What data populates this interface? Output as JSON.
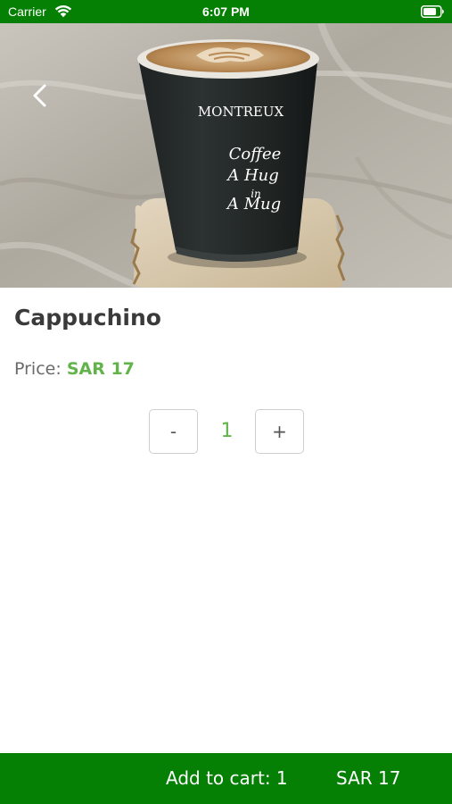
{
  "status_bar": {
    "carrier": "Carrier",
    "time": "6:07 PM",
    "wifi_icon": "wifi-icon",
    "battery_icon": "battery-icon"
  },
  "hero": {
    "cup_brand": "MONTREUX",
    "cup_slogan": [
      "Coffee",
      "A Hug",
      "in",
      "A Mug"
    ],
    "back_icon": "chevron-left-icon"
  },
  "product": {
    "name": "Cappuchino",
    "price_label": "Price:",
    "price_value": "SAR 17"
  },
  "quantity": {
    "minus_label": "-",
    "value": "1",
    "plus_label": "+"
  },
  "cart_bar": {
    "label": "Add to cart: 1",
    "total": "SAR 17"
  },
  "colors": {
    "brand_green": "#058004",
    "accent_green": "#62b34a",
    "title_text": "#3a3a3a",
    "muted_text": "#6a6a6a"
  }
}
